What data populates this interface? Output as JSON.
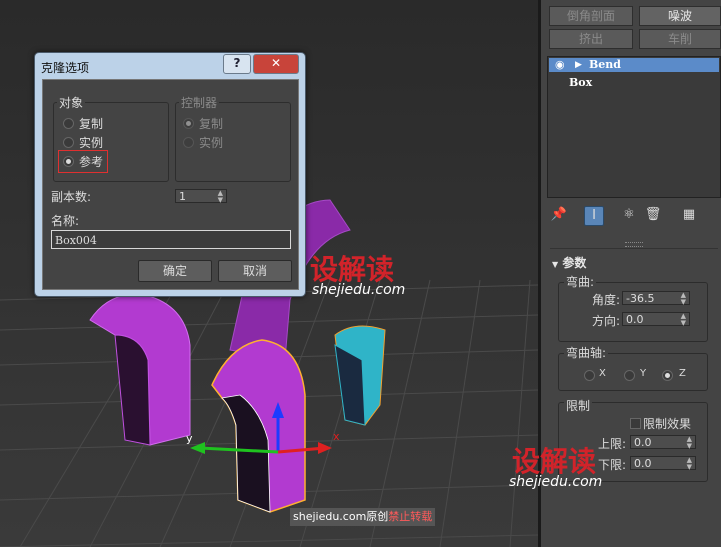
{
  "panel": {
    "top_buttons": [
      "倒角剖面",
      "噪波",
      "挤出",
      "车削"
    ],
    "stack": [
      "Bend",
      "Box"
    ],
    "rollout_title": "参数",
    "bend_group": "弯曲:",
    "angle_label": "角度:",
    "angle_value": "-36.5",
    "direction_label": "方向:",
    "direction_value": "0.0",
    "axis_group": "弯曲轴:",
    "axis_x": "X",
    "axis_y": "Y",
    "axis_z": "Z",
    "axis_selected": "Z",
    "limit_group": "限制",
    "limit_effect": "限制效果",
    "upper_label": "上限:",
    "upper_value": "0.0",
    "lower_label": "下限:",
    "lower_value": "0.0"
  },
  "dialog": {
    "title": "克隆选项",
    "help_button": "?",
    "close_button": "✕",
    "object_group": "对象",
    "controller_group": "控制器",
    "options": [
      "复制",
      "实例",
      "参考"
    ],
    "selected_option": "参考",
    "controller_options": [
      "复制",
      "实例"
    ],
    "copies_label": "副本数:",
    "copies_value": "1",
    "name_label": "名称:",
    "name_value": "Box004",
    "ok_button": "确定",
    "cancel_button": "取消"
  },
  "viewport": {
    "axis_y": "y",
    "axis_x": "x"
  },
  "watermark": {
    "logo_text": "设解读",
    "site": "shejiedu.com",
    "footer_site": "shejiedu.com原创",
    "footer_warning": "禁止转载"
  },
  "colors": {
    "selected_item": "#5b8bc9",
    "object_magenta": "#b23ad0",
    "object_teal": "#2fb4c8",
    "watermark_red": "#d2232a"
  }
}
